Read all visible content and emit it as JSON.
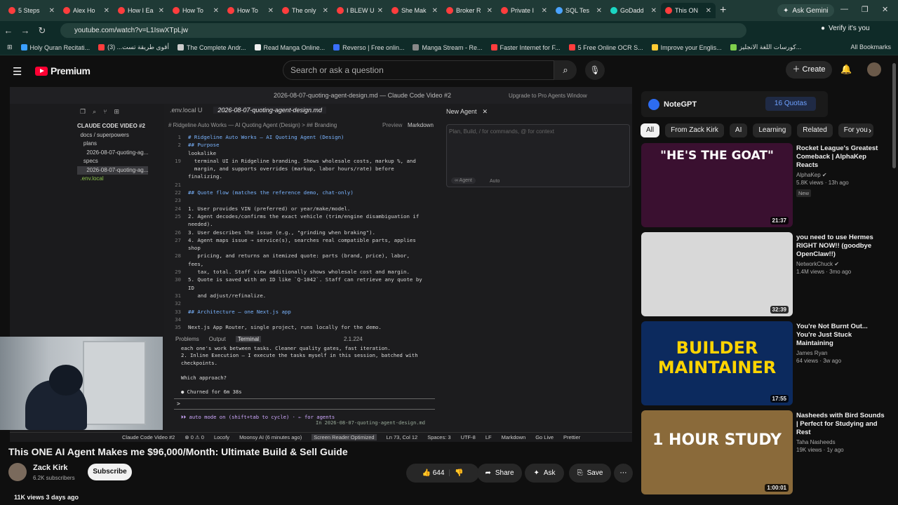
{
  "browser": {
    "tabs": [
      {
        "title": "5 Steps",
        "color": "#ff3d3d"
      },
      {
        "title": "Alex Ho",
        "color": "#ff3d3d"
      },
      {
        "title": "How I Ea",
        "color": "#ff3d3d"
      },
      {
        "title": "How To",
        "color": "#ff3d3d"
      },
      {
        "title": "How To",
        "color": "#ff3d3d"
      },
      {
        "title": "The only",
        "color": "#ff3d3d"
      },
      {
        "title": "I BLEW U",
        "color": "#ff3d3d"
      },
      {
        "title": "She Mak",
        "color": "#ff3d3d"
      },
      {
        "title": "Broker R",
        "color": "#ff3d3d"
      },
      {
        "title": "Private I",
        "color": "#ff3d3d"
      },
      {
        "title": "SQL Tes",
        "color": "#4aa3ff"
      },
      {
        "title": "GoDadd",
        "color": "#1bd6c3"
      },
      {
        "title": "This ON",
        "color": "#ff3d3d"
      }
    ],
    "gemini_label": "Ask Gemini",
    "url": "youtube.com/watch?v=L1IswXTpLjw",
    "profile_label": "Verify it's you",
    "bookmarks": [
      {
        "label": "Holy Quran Recitati...",
        "color": "#3aa0ff"
      },
      {
        "label": "أقوى طريقة تست... (3)",
        "color": "#ff3d3d"
      },
      {
        "label": "The Complete Andr...",
        "color": "#cccccc"
      },
      {
        "label": "Read Manga Online...",
        "color": "#eeeeee"
      },
      {
        "label": "Reverso | Free onlin...",
        "color": "#3a6fff"
      },
      {
        "label": "Manga Stream - Re...",
        "color": "#888888"
      },
      {
        "label": "Faster Internet for F...",
        "color": "#ff3d3d"
      },
      {
        "label": "5 Free Online OCR S...",
        "color": "#ff3d3d"
      },
      {
        "label": "Improve your Englis...",
        "color": "#ffcc33"
      },
      {
        "label": "كورسات اللغة الانجليز...",
        "color": "#7fd04c"
      }
    ],
    "all_bookmarks": "All Bookmarks"
  },
  "youtube": {
    "brand": "Premium",
    "search_placeholder": "Search or ask a question",
    "create_label": "Create"
  },
  "ide": {
    "window_title": "2026-08-07-quoting-agent-design.md — Claude Code Video #2",
    "upgrade": "Upgrade to Pro",
    "agents_window": "Agents Window",
    "tab1": ".env.local U",
    "tab2": "2026-08-07-quoting-agent-design.md",
    "agent_tab": "New Agent",
    "breadcrumb": "# Ridgeline Auto Works — AI Quoting Agent (Design) > ## Branding",
    "preview": "Preview",
    "markdown": "Markdown",
    "tree": [
      {
        "text": "CLAUDE CODE VIDEO #2",
        "cls": "h"
      },
      {
        "text": "  docs / superpowers",
        "cls": ""
      },
      {
        "text": "    plans",
        "cls": ""
      },
      {
        "text": "      2026-08-07-quoting-ag...",
        "cls": ""
      },
      {
        "text": "    specs",
        "cls": ""
      },
      {
        "text": "      2026-08-07-quoting-ag...",
        "cls": "sel"
      },
      {
        "text": "  .env.local",
        "cls": "green"
      }
    ],
    "code": [
      {
        "n": "1",
        "t": "# Ridgeline Auto Works — AI Quoting Agent (Design)",
        "h": true
      },
      {
        "n": "2",
        "t": "## Purpose",
        "h": true
      },
      {
        "n": "",
        "t": "lookalike",
        "h": false
      },
      {
        "n": "19",
        "t": "  terminal UI in Ridgeline branding. Shows wholesale costs, markup %, and",
        "h": false
      },
      {
        "n": "",
        "t": "  margin, and supports overrides (markup, labor hours/rate) before",
        "h": false
      },
      {
        "n": "",
        "t": "finalizing.",
        "h": false
      },
      {
        "n": "21",
        "t": "",
        "h": false
      },
      {
        "n": "22",
        "t": "## Quote flow (matches the reference demo, chat-only)",
        "h": true
      },
      {
        "n": "23",
        "t": "",
        "h": false
      },
      {
        "n": "24",
        "t": "1. User provides VIN (preferred) or year/make/model.",
        "h": false
      },
      {
        "n": "25",
        "t": "2. Agent decodes/confirms the exact vehicle (trim/engine disambiguation if",
        "h": false
      },
      {
        "n": "",
        "t": "needed).",
        "h": false
      },
      {
        "n": "26",
        "t": "3. User describes the issue (e.g., \"grinding when braking\").",
        "h": false
      },
      {
        "n": "27",
        "t": "4. Agent maps issue → service(s), searches real compatible parts, applies",
        "h": false
      },
      {
        "n": "",
        "t": "shop",
        "h": false
      },
      {
        "n": "28",
        "t": "   pricing, and returns an itemized quote: parts (brand, price), labor,",
        "h": false
      },
      {
        "n": "",
        "t": "fees,",
        "h": false
      },
      {
        "n": "29",
        "t": "   tax, total. Staff view additionally shows wholesale cost and margin.",
        "h": false
      },
      {
        "n": "30",
        "t": "5. Quote is saved with an ID like `Q-1042`. Staff can retrieve any quote by",
        "h": false
      },
      {
        "n": "",
        "t": "ID",
        "h": false
      },
      {
        "n": "31",
        "t": "   and adjust/refinalize.",
        "h": false
      },
      {
        "n": "32",
        "t": "",
        "h": false
      },
      {
        "n": "33",
        "t": "## Architecture — one Next.js app",
        "h": true
      },
      {
        "n": "34",
        "t": "",
        "h": false
      },
      {
        "n": "35",
        "t": "Next.js App Router, single project, runs locally for the demo.",
        "h": false
      }
    ],
    "panel_tabs": [
      "Problems",
      "Output",
      "Terminal"
    ],
    "panel_version": "2.1.224",
    "terminal": [
      {
        "t": "each one's work between tasks. Cleaner quality gates, fast iteration.",
        "b": false
      },
      {
        "t": "2. Inline Execution — I execute the tasks myself in this session, batched with",
        "b": false
      },
      {
        "t": "checkpoints.",
        "b": false
      },
      {
        "t": "",
        "b": false
      },
      {
        "t": "Which approach?",
        "b": false
      },
      {
        "t": "",
        "b": false
      },
      {
        "t": "● Churned for 6m 38s",
        "b": false
      }
    ],
    "prompt": ">",
    "auto_mode": "⏵⏵ auto mode on (shift+tab to cycle) · ← for agents",
    "auto_file": "In 2026-08-07-quoting-agent-design.md",
    "agent_placeholder": "Plan, Build, / for commands, @ for context",
    "agent_chip": "∞ Agent",
    "agent_auto": "Auto",
    "status_items": [
      "Claude Code Video #2",
      "⊗ 0 ⚠ 0",
      "Locofy",
      "Moonsy AI (6 minutes ago)",
      "Screen Reader Optimized",
      "Ln 73, Col 12",
      "Spaces: 3",
      "UTF-8",
      "LF",
      "Markdown",
      "Go Live",
      "Prettier"
    ]
  },
  "video_info": {
    "title": "This ONE AI Agent Makes me $96,000/Month: Ultimate Build & Sell Guide",
    "channel": "Zack Kirk",
    "subscribers": "6.2K subscribers",
    "subscribe": "Subscribe",
    "likes": "644",
    "share": "Share",
    "ask": "Ask",
    "save": "Save",
    "views": "11K views  3 days ago"
  },
  "notegpt": {
    "name": "NoteGPT",
    "quotas": "16 Quotas"
  },
  "chips": [
    "All",
    "From Zack Kirk",
    "AI",
    "Learning",
    "Related",
    "For you"
  ],
  "recommendations": [
    {
      "title": "Rocket League's Greatest Comeback | AlphaKep Reacts",
      "channel": "AlphaKep ✔",
      "meta": "5.8K views · 13h ago",
      "badge": "New",
      "duration": "21:37",
      "thumb_text": "\"HE'S THE GOAT\"",
      "thumb_bg": "#3a1030",
      "thumb_color": "#ffffff"
    },
    {
      "title": "you need to use Hermes RIGHT NOW!! (goodbye OpenClaw!!)",
      "channel": "NetworkChuck ✔",
      "meta": "1.4M views · 3mo ago",
      "badge": "",
      "duration": "32:39",
      "thumb_text": "",
      "thumb_bg": "#d8d8d8",
      "thumb_color": "#000000"
    },
    {
      "title": "You're Not Burnt Out... You're Just Stuck Maintaining",
      "channel": "James Ryan",
      "meta": "64 views · 3w ago",
      "badge": "",
      "duration": "17:55",
      "thumb_text": "BUILDER MAINTAINER",
      "thumb_bg": "#0c2a5e",
      "thumb_color": "#ffd400"
    },
    {
      "title": "Nasheeds with Bird Sounds | Perfect for Studying and Rest",
      "channel": "Taha Nasheeds",
      "meta": "19K views · 1y ago",
      "badge": "",
      "duration": "1:00:01",
      "thumb_text": "1 HOUR STUDY",
      "thumb_bg": "#8a6a3a",
      "thumb_color": "#ffffff"
    }
  ]
}
